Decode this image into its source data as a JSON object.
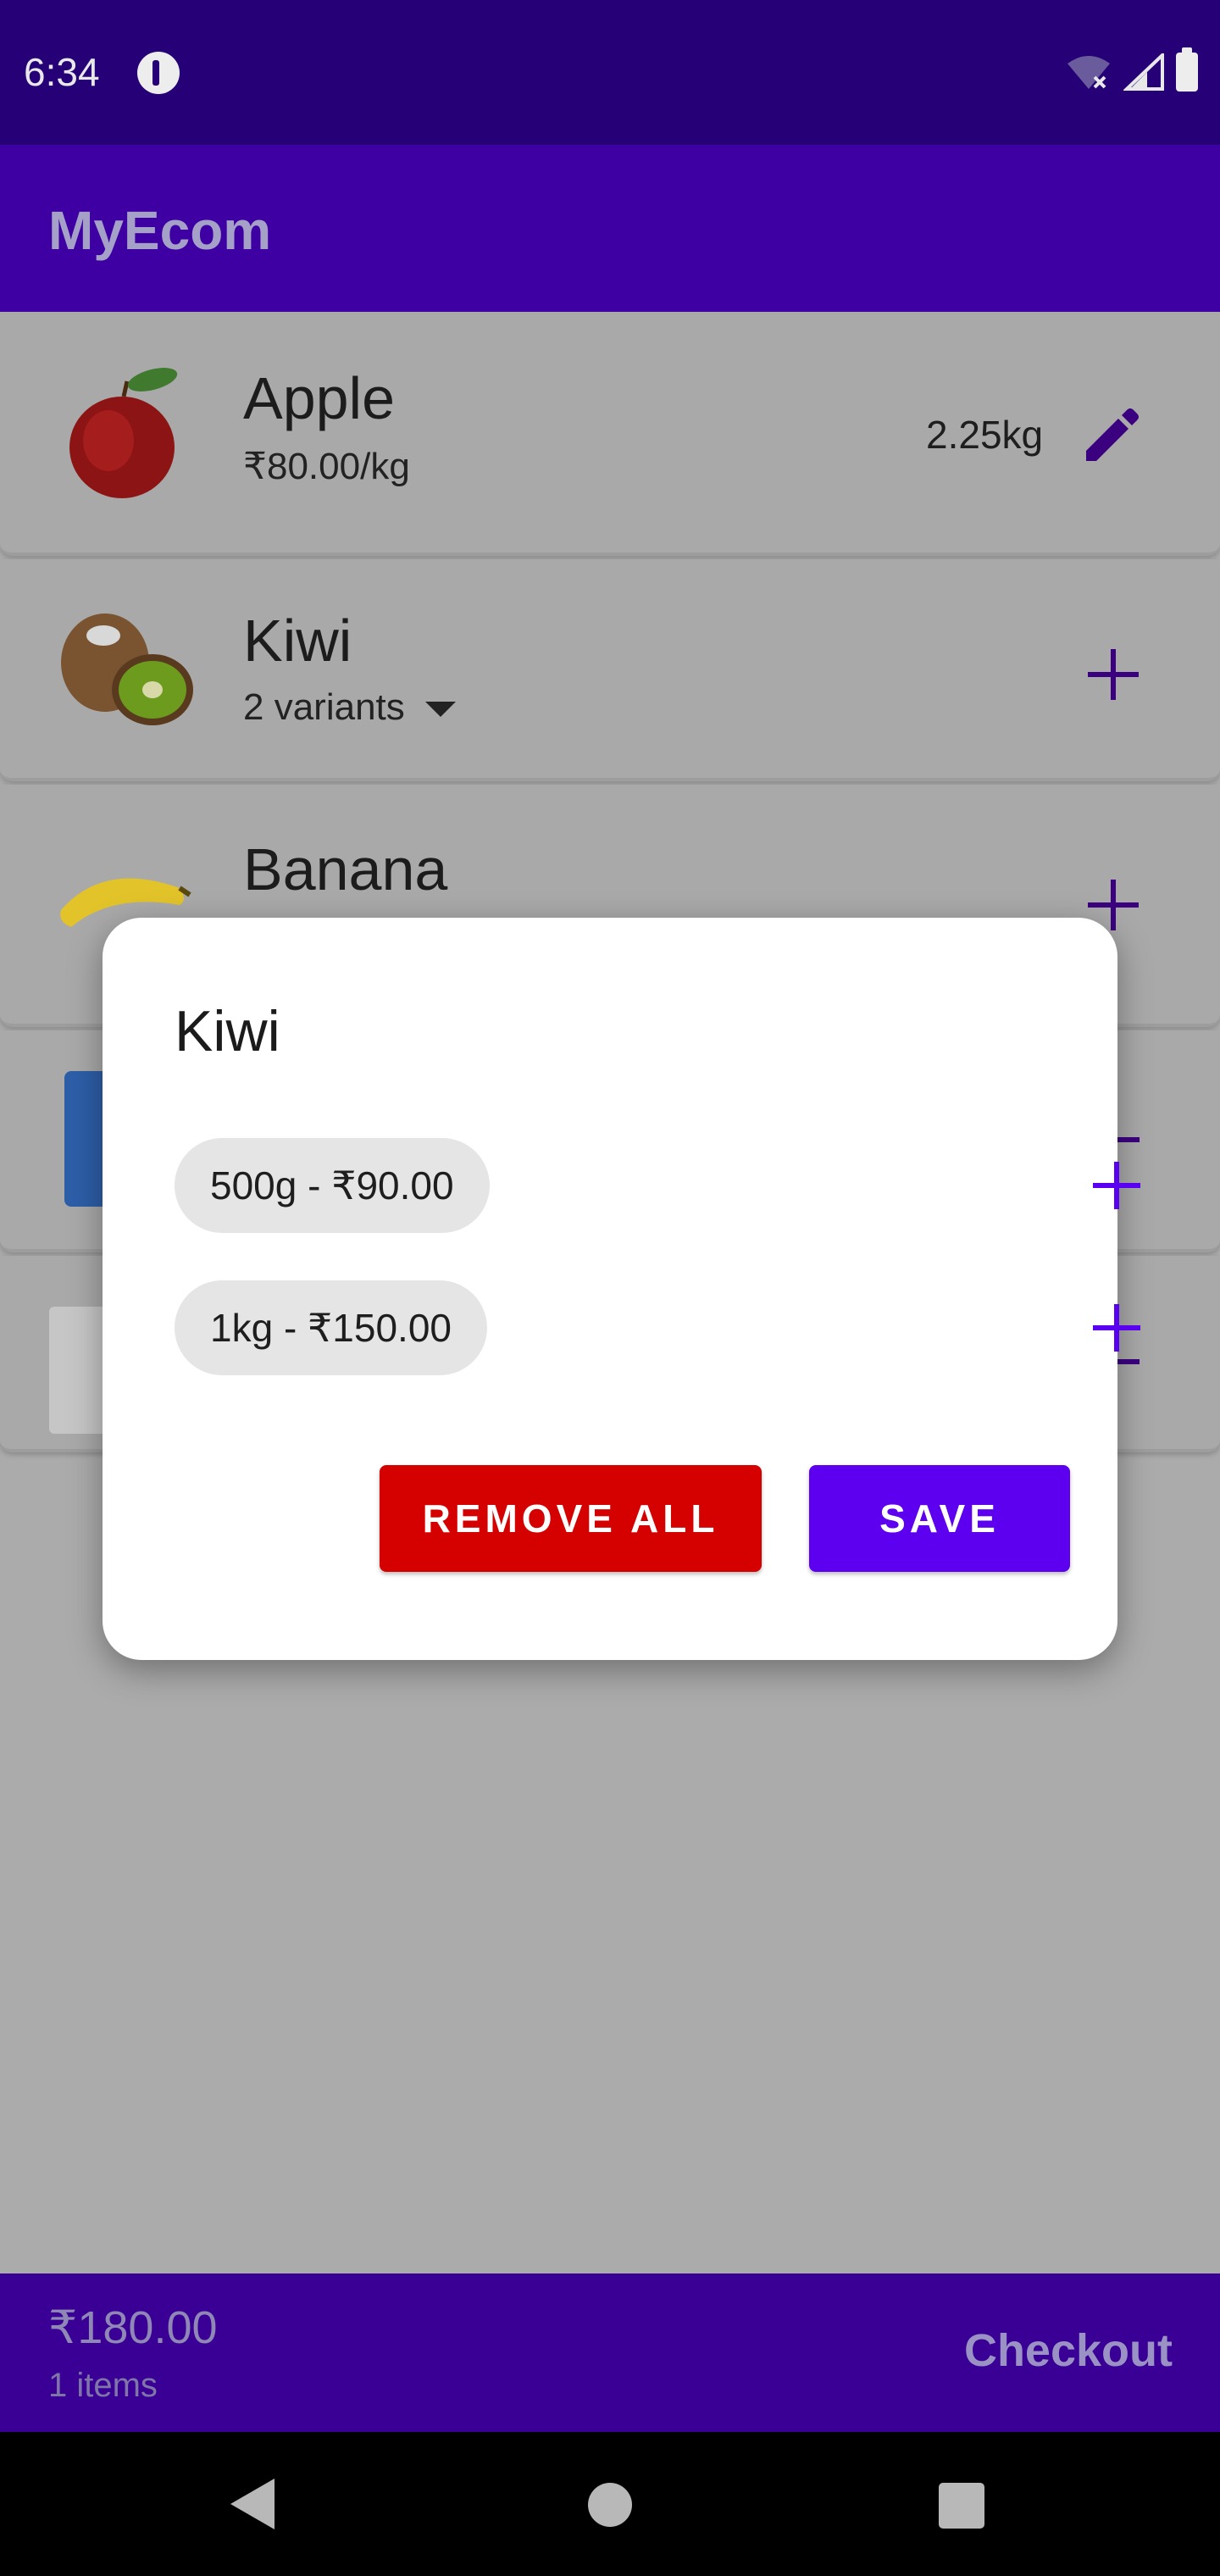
{
  "status_bar": {
    "time": "6:34",
    "icons": [
      "app-notification-icon",
      "wifi-off-icon",
      "signal-icon",
      "battery-icon"
    ]
  },
  "app_bar": {
    "title": "MyEcom"
  },
  "products": [
    {
      "name": "Apple",
      "subtitle": "₹80.00/kg",
      "quantity": "2.25kg",
      "action_icon": "edit-icon"
    },
    {
      "name": "Kiwi",
      "subtitle": "2 variants",
      "action_icon": "add-icon"
    },
    {
      "name": "Banana",
      "action_icon": "add-icon"
    },
    {
      "action_icon": "remove-icon"
    },
    {
      "action_icon": "remove-icon"
    }
  ],
  "cart_bar": {
    "total": "₹180.00",
    "items": "1 items",
    "checkout_label": "Checkout"
  },
  "dialog": {
    "title": "Kiwi",
    "variants": [
      {
        "label": "500g - ₹90.00"
      },
      {
        "label": "1kg - ₹150.00"
      }
    ],
    "remove_all_label": "REMOVE ALL",
    "save_label": "SAVE"
  },
  "colors": {
    "primary": "#6200ee",
    "primary_dark": "#3700b3",
    "danger": "#d50000",
    "scrim": "rgba(0,0,0,0.33)"
  }
}
